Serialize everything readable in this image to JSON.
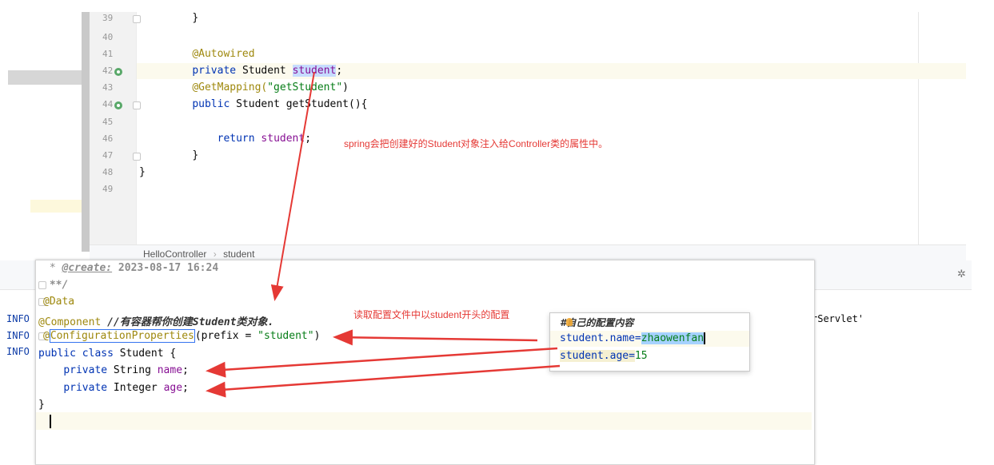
{
  "top_editor": {
    "lines": [
      {
        "num": "39",
        "text": "    }"
      },
      {
        "num": "40",
        "text": ""
      },
      {
        "num": "41",
        "anno": "@Autowired"
      },
      {
        "num": "42",
        "kw": "private",
        "type": "Student",
        "field": "student",
        "end": ";"
      },
      {
        "num": "43",
        "anno": "@GetMapping(",
        "str": "\"getStudent\"",
        "end": ")"
      },
      {
        "num": "44",
        "kw": "public",
        "type": "Student",
        "method": "getStudent(){"
      },
      {
        "num": "45",
        "text": ""
      },
      {
        "num": "46",
        "kw": "return",
        "field": "student",
        "end": ";"
      },
      {
        "num": "47",
        "text": "}"
      },
      {
        "num": "48",
        "text": "}"
      },
      {
        "num": "49",
        "text": ""
      }
    ],
    "breadcrumb": [
      "HelloController",
      "student"
    ],
    "note": "spring会把创建好的Student对象注入给Controller类的属性中。"
  },
  "bottom_editor": {
    "doc_line1_prefix": " * ",
    "doc_line1_tag": "@create:",
    "doc_line1_value": " 2023-08-17 16:24",
    "doc_line2": " **/",
    "line_data": "@Data",
    "line_component": "@Component",
    "line_component_comment": "//有容器帮你创建Student类对象.",
    "line_config_prefix": "@",
    "line_config_name": "ConfigurationProperties",
    "line_config_args_open": "(prefix = ",
    "line_config_str": "\"student\"",
    "line_config_args_close": ")",
    "line_class_kw": "public class",
    "line_class_name": " Student {",
    "field_name_kw": "private",
    "field_name_type": " String ",
    "field_name": "name",
    "field_age_kw": "private",
    "field_age_type": " Integer ",
    "field_age": "age",
    "line_close": "}",
    "note": "读取配置文件中以student开头的配置"
  },
  "log": {
    "prefix": "INFO",
    "right_text": "rServlet'"
  },
  "config_popup": {
    "comment": "#自己的配置内容",
    "line1_key": "student.name=",
    "line1_value": "zhaowenfan",
    "line2_key": "student.age=",
    "line2_value": "15"
  },
  "colors": {
    "arrow": "#e53935",
    "keyword": "#0033b3",
    "annotation": "#9e880d",
    "string": "#067d17",
    "field": "#871094"
  }
}
